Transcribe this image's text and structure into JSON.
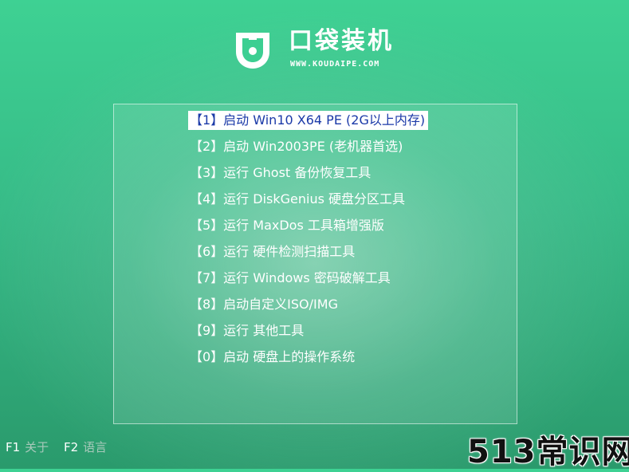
{
  "brand": {
    "title": "口袋装机",
    "url": "WWW.KOUDAIPE.COM",
    "logo_icon": "shield-logo-icon"
  },
  "menu": {
    "selected_index": 0,
    "items": [
      {
        "label": "【1】启动 Win10 X64 PE (2G以上内存)"
      },
      {
        "label": "【2】启动 Win2003PE (老机器首选)"
      },
      {
        "label": "【3】运行 Ghost 备份恢复工具"
      },
      {
        "label": "【4】运行 DiskGenius 硬盘分区工具"
      },
      {
        "label": "【5】运行 MaxDos 工具箱增强版"
      },
      {
        "label": "【6】运行 硬件检测扫描工具"
      },
      {
        "label": "【7】运行 Windows 密码破解工具"
      },
      {
        "label": "【8】启动自定义ISO/IMG"
      },
      {
        "label": "【9】运行 其他工具"
      },
      {
        "label": "【0】启动 硬盘上的操作系统"
      }
    ]
  },
  "footer": {
    "f1_key": "F1",
    "f1_label": "关于",
    "f2_key": "F2",
    "f2_label": "语言"
  },
  "watermark": {
    "text": "513常识网"
  },
  "colors": {
    "bg_top": "#3ed193",
    "bg_bottom": "#2a9a6c",
    "selected_text": "#1b3aa8",
    "footer_label": "#a8c9bb"
  }
}
